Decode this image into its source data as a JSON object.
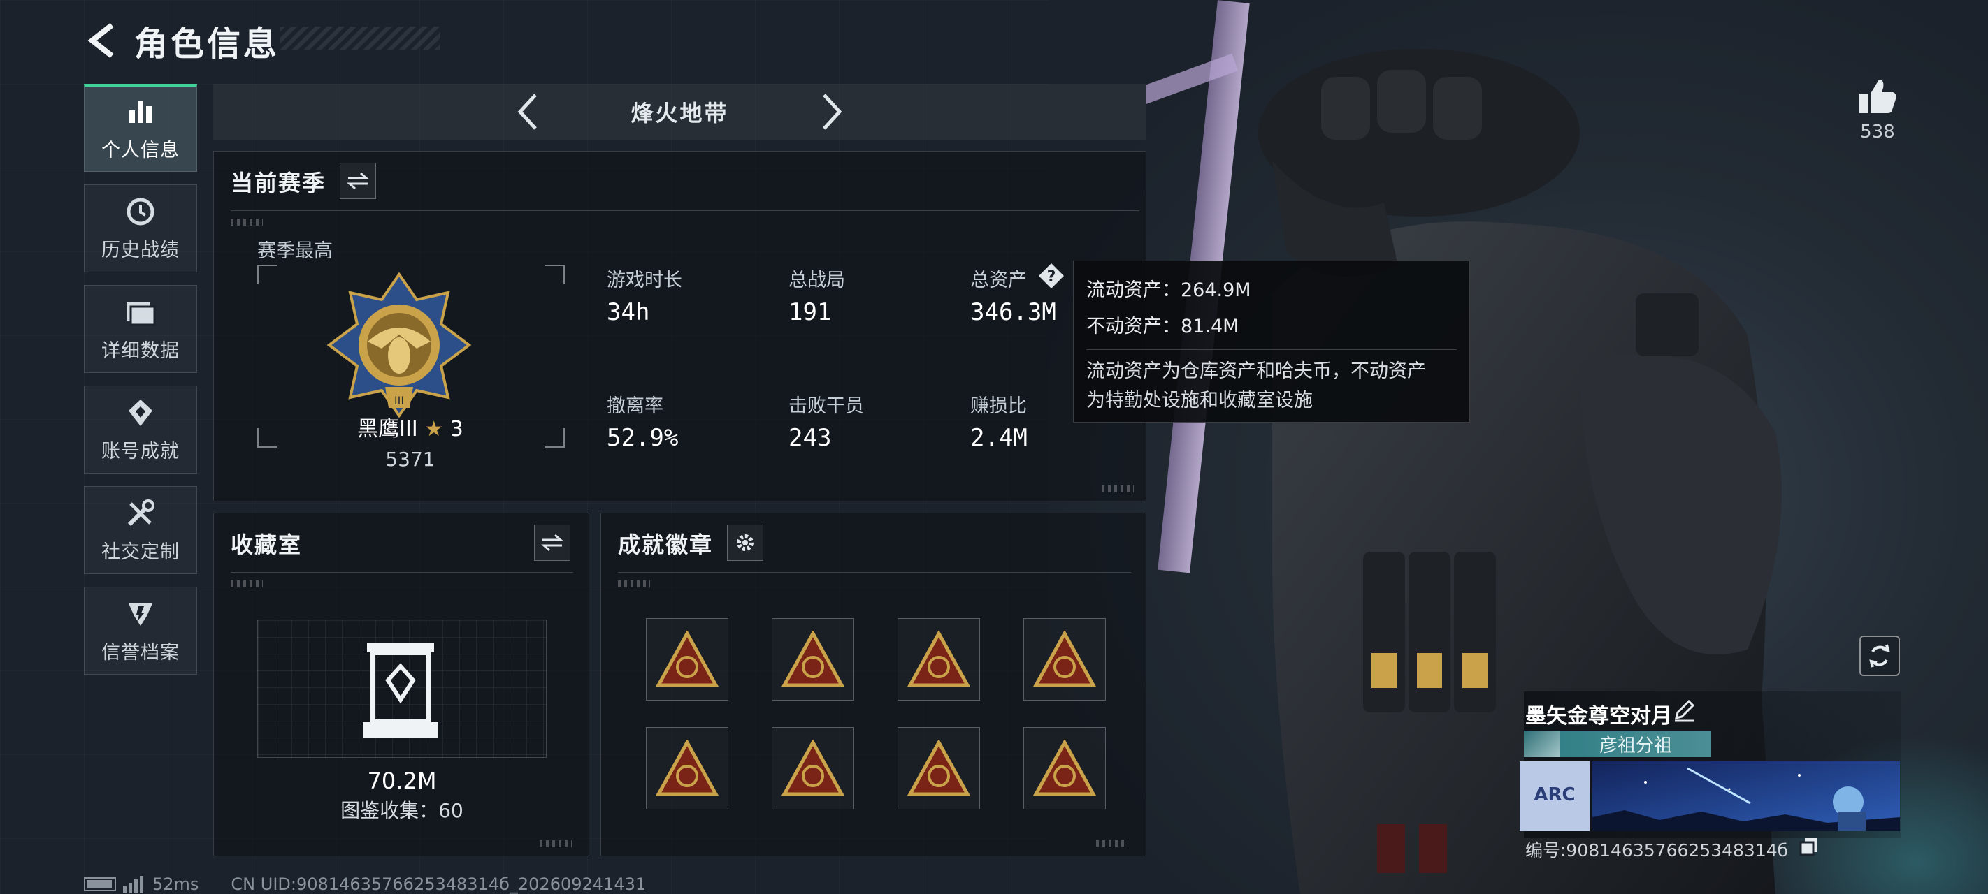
{
  "header": {
    "title": "角色信息"
  },
  "sidebar": {
    "items": [
      {
        "label": "个人信息",
        "icon": "bar-chart-icon",
        "active": true
      },
      {
        "label": "历史战绩",
        "icon": "history-clock-icon",
        "active": false
      },
      {
        "label": "详细数据",
        "icon": "folder-icon",
        "active": false
      },
      {
        "label": "账号成就",
        "icon": "achievement-icon",
        "active": false
      },
      {
        "label": "社交定制",
        "icon": "wrench-tools-icon",
        "active": false
      },
      {
        "label": "信誉档案",
        "icon": "shield-emblem-icon",
        "active": false
      }
    ]
  },
  "mode": {
    "title": "烽火地带"
  },
  "season": {
    "title": "当前赛季",
    "best_label": "赛季最高",
    "rank_name": "黑鹰III",
    "rank_stars": "3",
    "rank_score": "5371",
    "stats": [
      {
        "label": "游戏时长",
        "value": "34h"
      },
      {
        "label": "总战局",
        "value": "191"
      },
      {
        "label": "总资产",
        "value": "346.3M"
      },
      {
        "label": "撤离率",
        "value": "52.9%"
      },
      {
        "label": "击败干员",
        "value": "243"
      },
      {
        "label": "赚损比",
        "value": "2.4M"
      }
    ]
  },
  "tooltip": {
    "liquid": "流动资产：264.9M",
    "fixed": "不动资产：81.4M",
    "desc_line1": "流动资产为仓库资产和哈夫币，不动资产",
    "desc_line2": "为特勤处设施和收藏室设施"
  },
  "collection": {
    "title": "收藏室",
    "value": "70.2M",
    "count": "图鉴收集：60"
  },
  "badges": {
    "title": "成就徽章",
    "items": [
      "badge-1",
      "badge-2",
      "badge-3",
      "badge-4",
      "badge-5",
      "badge-6",
      "badge-7",
      "badge-8"
    ]
  },
  "profile": {
    "likes": "538",
    "name": "墨矢金尊空对月",
    "team": "彦祖分祖",
    "banner_text": "ARC",
    "uid": "编号:9081463576625348314б"
  },
  "status_bar": {
    "ping": "52ms",
    "uid": "CN UID:9081463576625348314б_202609241431"
  },
  "colors": {
    "accent": "#3fd39a",
    "gold": "#c9a24a",
    "badge_red": "#7a2418"
  }
}
